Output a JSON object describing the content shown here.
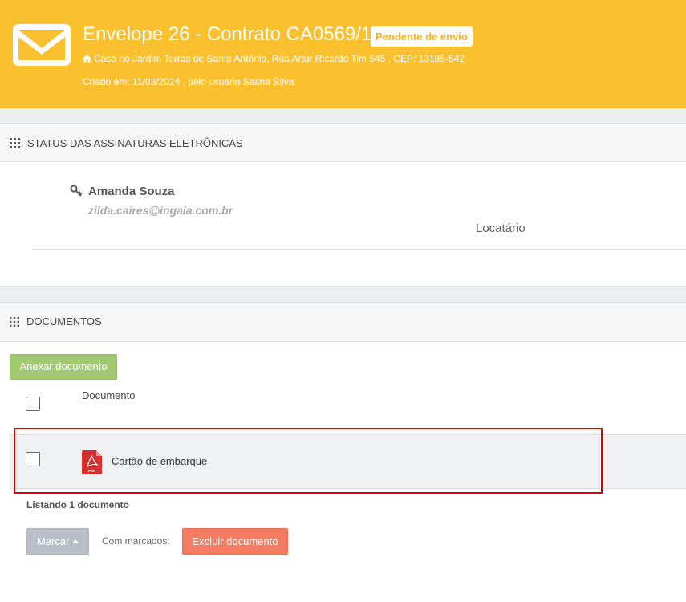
{
  "header": {
    "icon": "envelope-icon",
    "title": "Envelope 26 - Contrato CA0569/1",
    "status_badge": "Pendente de envio",
    "address": "Casa no Jardim Terras de Santo Antônio, Rua Artur Ricardo Tim 545 , CEP: 13185-542",
    "created": "Criado em: 11/03/2024 , pelo usuário Sasha Silva.",
    "colors": {
      "background": "#fbc02d",
      "badge_text": "#f6b21b"
    }
  },
  "signatures_section": {
    "title": "STATUS DAS ASSINATURAS ELETRÔNICAS",
    "signers": [
      {
        "name": "Amanda Souza",
        "email": "zilda.caires@ingaia.com.br",
        "role": "Locatário",
        "icon": "key-icon"
      }
    ]
  },
  "documents_section": {
    "title": "DOCUMENTOS",
    "attach_button": "Anexar documento",
    "column_header": "Documento",
    "rows": [
      {
        "name": "Cartão de embarque",
        "icon": "pdf-icon",
        "checked": false
      }
    ],
    "listing": "Listando 1 documento",
    "mark_button": "Marcar",
    "with_marked_label": "Com marcados:",
    "delete_button": "Excluir documento",
    "colors": {
      "attach": "#a0c971",
      "mark": "#b9bec7",
      "delete": "#f47c62",
      "highlight": "#e00000"
    }
  }
}
